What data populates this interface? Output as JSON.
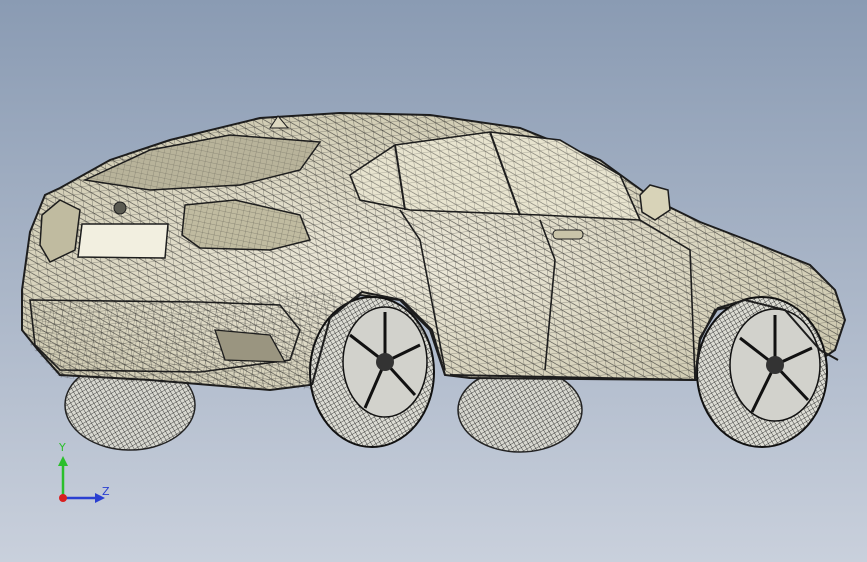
{
  "viewport": {
    "background_top": "#8a9bb3",
    "background_bottom": "#c9d0dc",
    "model": {
      "display_mode": "shaded-with-edges",
      "body_color": "#e3dfc6",
      "edge_color": "#1d1d1d"
    }
  },
  "triad": {
    "y_label": "Y",
    "z_label": "Z",
    "y_color": "#2bbf2b",
    "z_color": "#2a3fd1",
    "origin_color": "#d81f1f"
  }
}
